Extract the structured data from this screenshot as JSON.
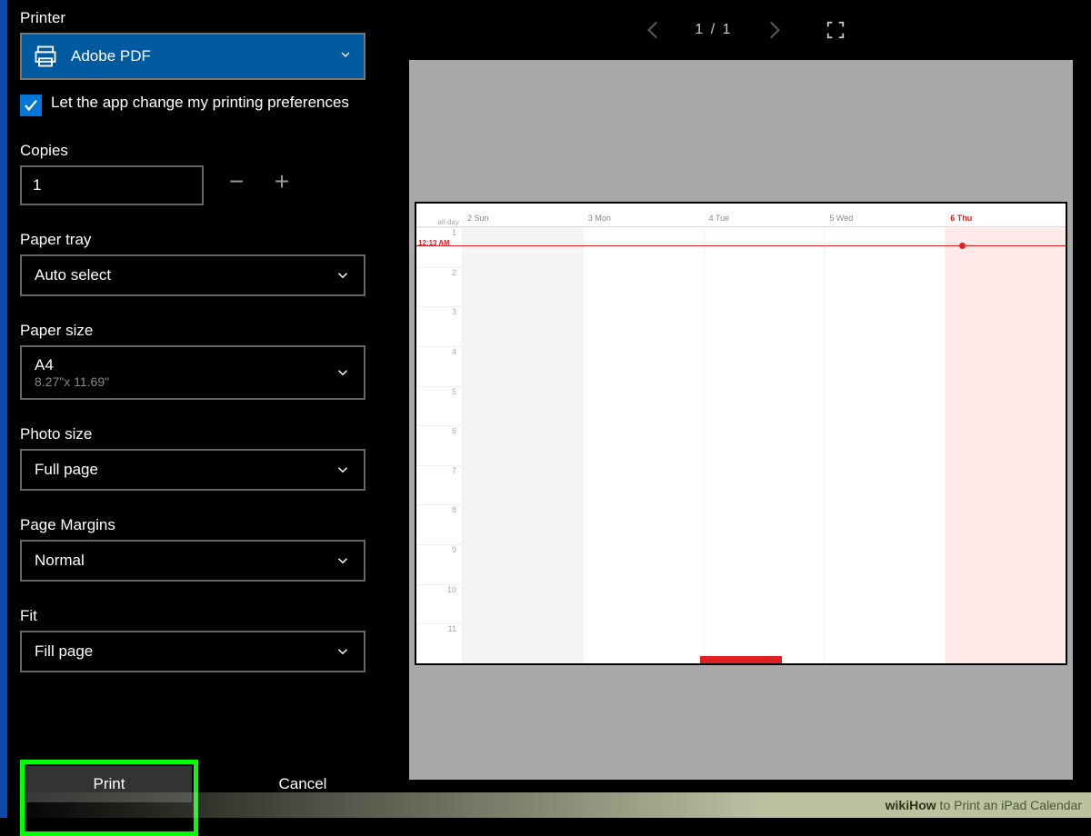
{
  "panel": {
    "printer_label": "Printer",
    "printer_selected": "Adobe PDF",
    "pref_checkbox_label": "Let the app change my printing preferences",
    "copies_label": "Copies",
    "copies_value": "1",
    "paper_tray_label": "Paper tray",
    "paper_tray_value": "Auto select",
    "paper_size_label": "Paper size",
    "paper_size_value": "A4",
    "paper_size_sub": "8.27\"x 11.69\"",
    "photo_size_label": "Photo size",
    "photo_size_value": "Full page",
    "page_margins_label": "Page Margins",
    "page_margins_value": "Normal",
    "fit_label": "Fit",
    "fit_value": "Fill page",
    "print_button": "Print",
    "cancel_button": "Cancel"
  },
  "preview": {
    "page_indicator": "1  /  1",
    "calendar": {
      "time_marker": "12:13 AM",
      "allday_label": "all-day",
      "days": [
        {
          "n": "2",
          "d": "Sun"
        },
        {
          "n": "3",
          "d": "Mon"
        },
        {
          "n": "4",
          "d": "Tue"
        },
        {
          "n": "5",
          "d": "Wed"
        },
        {
          "n": "6",
          "d": "Thu"
        }
      ],
      "hours": [
        "1",
        "2",
        "3",
        "4",
        "5",
        "6",
        "7",
        "8",
        "9",
        "10",
        "11"
      ]
    }
  },
  "footer": {
    "brand_bold": "wikiHow",
    "title_rest": " to Print an iPad Calendar"
  }
}
